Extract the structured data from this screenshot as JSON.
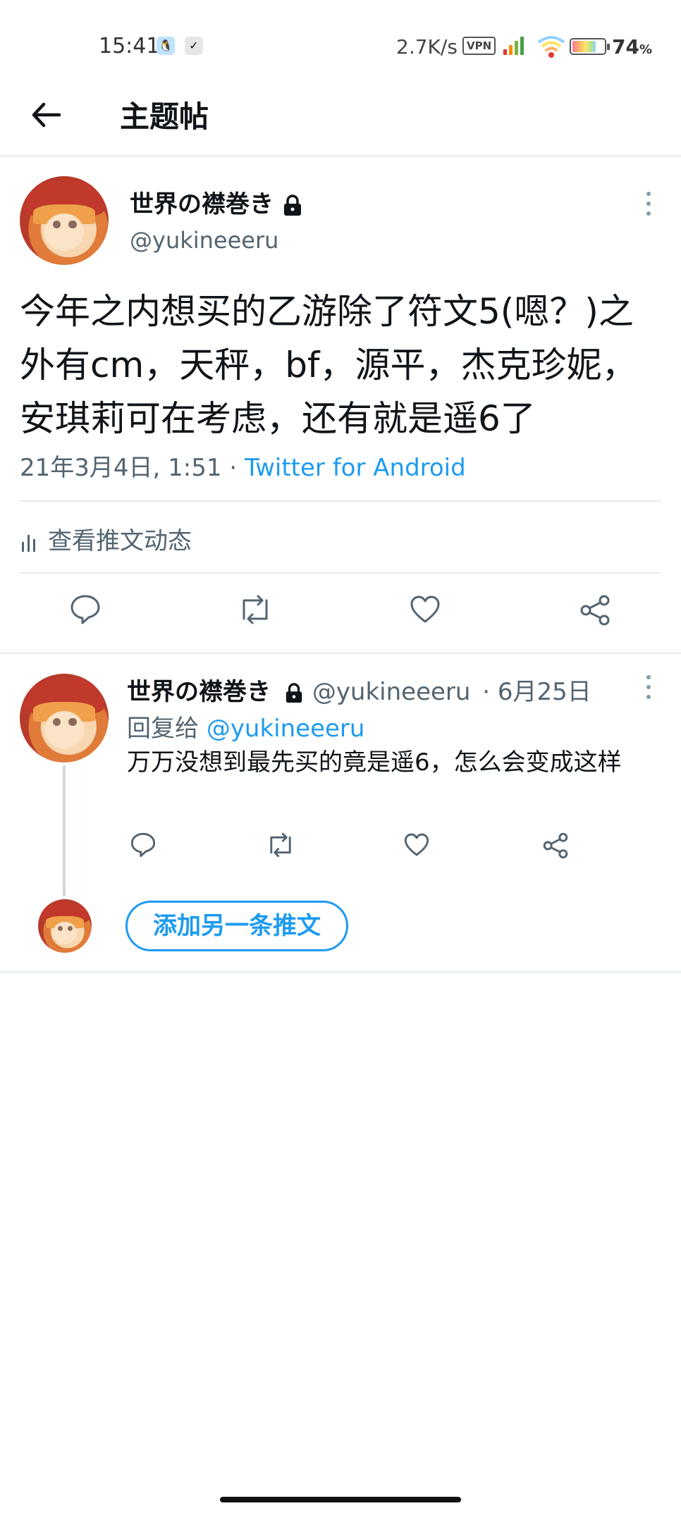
{
  "status_bar": {
    "time": "15:41",
    "net_speed": "2.7K/s",
    "vpn_label": "VPN",
    "battery_percent": "74",
    "battery_unit": "%",
    "battery_level": 0.74
  },
  "header": {
    "title": "主题帖"
  },
  "main_tweet": {
    "display_name": "世界の襟巻き",
    "handle": "@yukineeeru",
    "text": "今年之内想买的乙游除了符文5(嗯？)之外有cm，天秤，bf，源平，杰克珍妮，安琪莉可在考虑，还有就是遥6了",
    "timestamp": "21年3月4日, 1:51",
    "separator": " · ",
    "client": "Twitter for Android",
    "analytics_label": "查看推文动态"
  },
  "reply_tweet": {
    "display_name": "世界の襟巻き",
    "handle": "@yukineeeru",
    "date": "· 6月25日",
    "reply_prefix": "回复给",
    "reply_to_handle": "@yukineeeru",
    "text": "万万没想到最先买的竟是遥6，怎么会变成这样"
  },
  "add_tweet_button": "添加另一条推文",
  "colors": {
    "accent": "#1d9bf0",
    "secondary_text": "#536471",
    "divider": "#e6ecf0"
  }
}
